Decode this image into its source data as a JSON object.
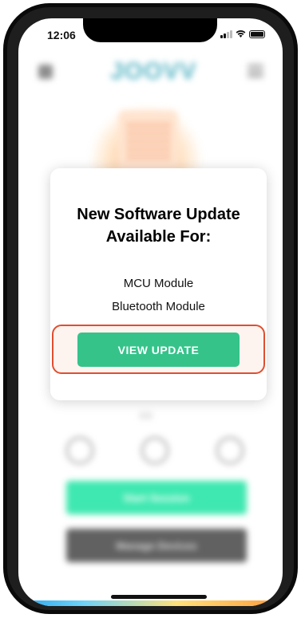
{
  "status_bar": {
    "time": "12:06"
  },
  "background_app": {
    "logo": "JOOVV",
    "timer": "0:0",
    "start_button": "Start Session",
    "manage_button": "Manage Devices"
  },
  "modal": {
    "title_line1": "New Software Update",
    "title_line2": "Available For:",
    "modules": [
      "MCU Module",
      "Bluetooth Module"
    ],
    "view_update_button": "VIEW UPDATE"
  },
  "colors": {
    "accent_green": "#35c38a",
    "highlight_border": "#e04e2f",
    "start_green": "#3ee8b0",
    "manage_gray": "#616161"
  }
}
